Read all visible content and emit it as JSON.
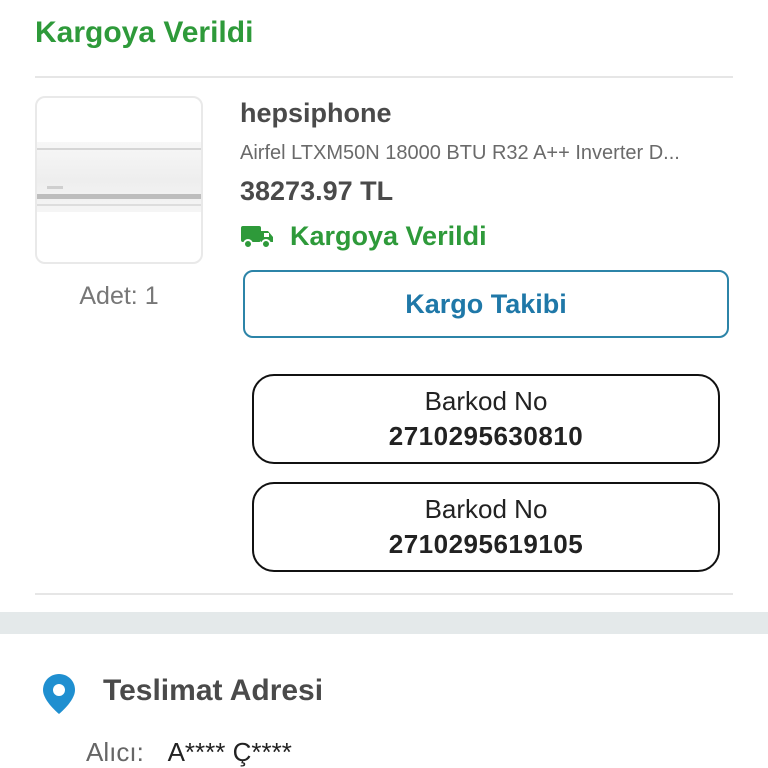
{
  "order": {
    "status_title": "Kargoya Verildi"
  },
  "product": {
    "quantity_label": "Adet: 1",
    "seller": "hepsiphone",
    "name": "Airfel LTXM50N 18000 BTU R32 A++ Inverter D...",
    "price": "38273.97 TL",
    "shipping_status": "Kargoya Verildi",
    "track_button_label": "Kargo Takibi",
    "barcodes": [
      {
        "label": "Barkod No",
        "value": "2710295630810"
      },
      {
        "label": "Barkod No",
        "value": "2710295619105"
      }
    ]
  },
  "address": {
    "title": "Teslimat Adresi",
    "recipient_label": "Alıcı:",
    "recipient_name": "A**** Ç****"
  },
  "icons": {
    "truck": "truck-icon",
    "pin": "location-pin-icon"
  },
  "colors": {
    "status_green": "#2e9a3a",
    "link_blue": "#1f78a8",
    "pin_blue": "#1f8fd0"
  }
}
